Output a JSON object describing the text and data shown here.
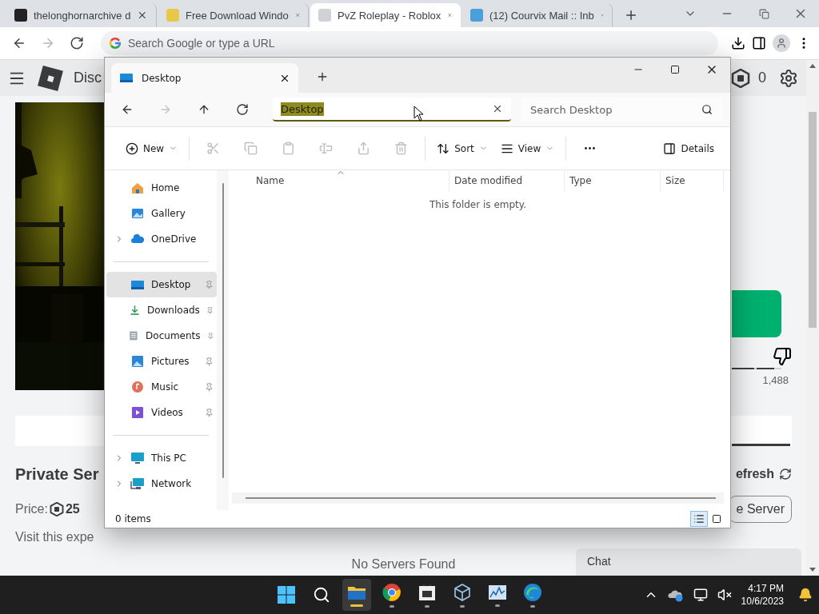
{
  "browser": {
    "tabs": [
      {
        "title": "thelonghornarchive d",
        "selected": false
      },
      {
        "title": "Free Download Windo",
        "selected": false
      },
      {
        "title": "PvZ Roleplay - Roblox",
        "selected": true
      },
      {
        "title": "(12) Courvix Mail :: Inb",
        "selected": false
      }
    ],
    "nav_buttons": [
      {
        "disabled": false
      },
      {
        "disabled": true
      },
      {
        "disabled": false
      }
    ],
    "address_bar": {
      "placeholder": "Search Google or type a URL"
    }
  },
  "roblox": {
    "header": {
      "nav_label": "Disc",
      "robux_balance": "0"
    },
    "dislike_count": "1,488",
    "private_servers": {
      "title": "Private Ser",
      "refresh_label": "efresh",
      "price_label": "Price:",
      "price": "25",
      "create_button": "e Server",
      "description": "Visit this expe"
    },
    "empty_message": "No Servers Found",
    "chat": {
      "label": "Chat"
    }
  },
  "explorer": {
    "tab": {
      "title": "Desktop"
    },
    "nav_buttons": [
      {
        "disabled": false
      },
      {
        "disabled": true
      },
      {
        "disabled": false
      },
      {
        "disabled": false
      }
    ],
    "address": {
      "value": "Desktop",
      "text_selected": true
    },
    "search": {
      "placeholder": "Search Desktop"
    },
    "commands": [
      {
        "kind": "menu",
        "label": "New",
        "disabled": false
      },
      {
        "kind": "icon",
        "disabled": true
      },
      {
        "kind": "icon",
        "disabled": true
      },
      {
        "kind": "icon",
        "disabled": true
      },
      {
        "kind": "icon",
        "disabled": true
      },
      {
        "kind": "icon",
        "disabled": true
      },
      {
        "kind": "icon",
        "disabled": true
      },
      {
        "kind": "menu",
        "label": "Sort",
        "disabled": false
      },
      {
        "kind": "menu",
        "label": "View",
        "disabled": false
      },
      {
        "kind": "icon",
        "disabled": false
      },
      {
        "kind": "toggle",
        "label": "Details",
        "disabled": false
      }
    ],
    "navigation": [
      [
        {
          "label": "Home",
          "kind": "plain",
          "selected": false
        },
        {
          "label": "Gallery",
          "kind": "plain",
          "selected": false
        },
        {
          "label": "OneDrive",
          "kind": "tree",
          "expanded": false,
          "selected": false
        }
      ],
      [
        {
          "label": "Desktop",
          "kind": "pinned",
          "selected": true
        },
        {
          "label": "Downloads",
          "kind": "pinned",
          "selected": false
        },
        {
          "label": "Documents",
          "kind": "pinned",
          "selected": false
        },
        {
          "label": "Pictures",
          "kind": "pinned",
          "selected": false
        },
        {
          "label": "Music",
          "kind": "pinned",
          "selected": false
        },
        {
          "label": "Videos",
          "kind": "pinned",
          "selected": false
        }
      ],
      [
        {
          "label": "This PC",
          "kind": "tree",
          "expanded": false,
          "selected": false
        },
        {
          "label": "Network",
          "kind": "tree",
          "expanded": false,
          "selected": false
        }
      ]
    ],
    "columns": [
      {
        "label": "Name",
        "sorted": true
      },
      {
        "label": "Date modified",
        "sorted": false
      },
      {
        "label": "Type",
        "sorted": false
      },
      {
        "label": "Size",
        "sorted": false
      }
    ],
    "empty_message": "This folder is empty.",
    "status": "0 items",
    "view_modes": [
      {
        "selected": true
      },
      {
        "selected": false
      }
    ]
  },
  "taskbar": {
    "apps": [
      {
        "active": true,
        "running": true
      },
      {
        "active": false,
        "running": true
      },
      {
        "active": false,
        "running": true
      },
      {
        "active": false,
        "running": true
      },
      {
        "active": false,
        "running": true
      },
      {
        "active": false,
        "running": true
      }
    ],
    "clock": {
      "time": "4:17 PM",
      "date": "10/6/2023"
    }
  }
}
